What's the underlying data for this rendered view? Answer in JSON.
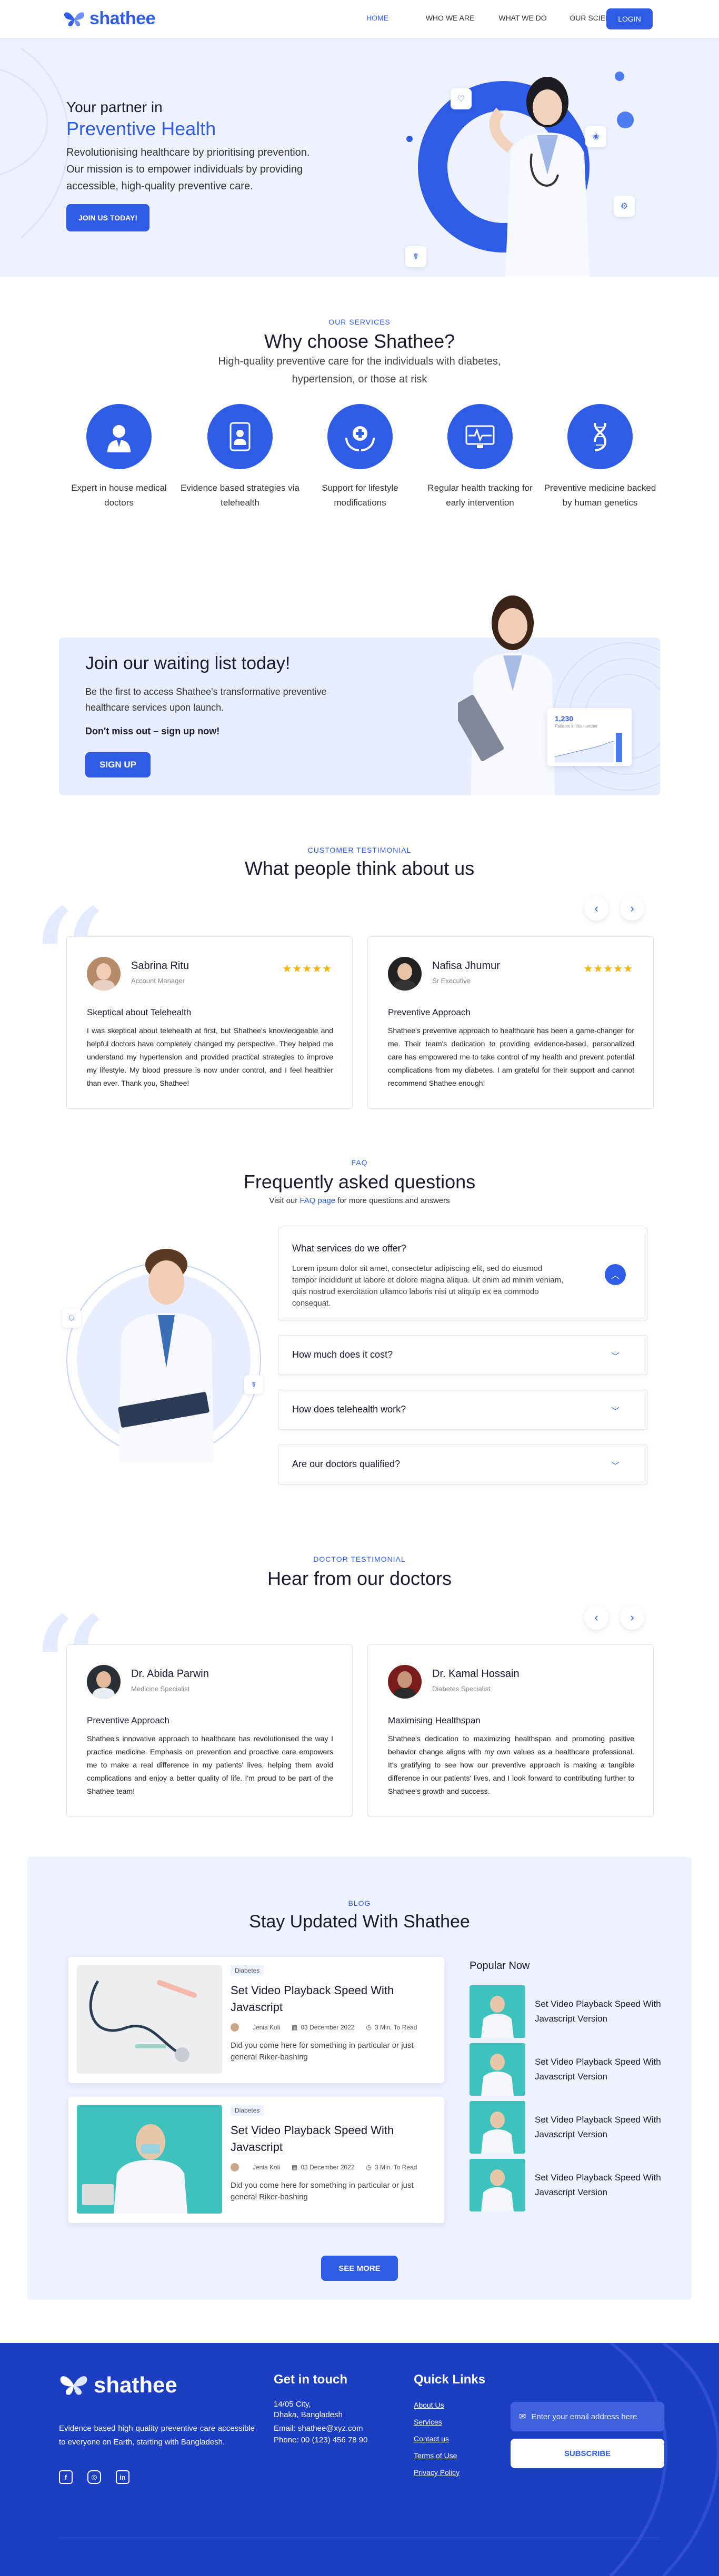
{
  "brand": {
    "name": "shathee",
    "accent": "#2e5ce6",
    "footer_bg": "#1c3ec2"
  },
  "nav": {
    "items": [
      "HOME",
      "WHO WE ARE",
      "WHAT WE DO",
      "OUR SCIENCE"
    ],
    "active": "HOME",
    "login": "LOGIN"
  },
  "hero": {
    "tagline": "Your partner in",
    "headline": "Preventive Health",
    "description": "Revolutionising healthcare by prioritising prevention. Our mission is to empower individuals by providing accessible, high-quality preventive care.",
    "cta": "JOIN US TODAY!"
  },
  "services": {
    "eyebrow": "OUR SERVICES",
    "title": "Why choose Shathee?",
    "subtitle": "High-quality preventive care for the individuals with diabetes, hypertension, or those at risk",
    "items": [
      {
        "label": "Expert in house medical doctors",
        "icon": "doctor-icon"
      },
      {
        "label": "Evidence based strategies via telehealth",
        "icon": "telehealth-icon"
      },
      {
        "label": "Support for lifestyle modifications",
        "icon": "care-hands-icon"
      },
      {
        "label": "Regular health tracking for early intervention",
        "icon": "monitor-icon"
      },
      {
        "label": "Preventive medicine backed by human genetics",
        "icon": "dna-icon"
      }
    ]
  },
  "waitlist": {
    "title": "Join our waiting list today!",
    "text": "Be the first to access Shathee's transformative preventive healthcare services upon launch.",
    "emphasis": "Don't miss out – sign up now!",
    "cta": "SIGN UP",
    "stat_value": "1,230",
    "stat_label": "Patients in this number"
  },
  "customer_testimonials": {
    "eyebrow": "CUSTOMER TESTIMONIAL",
    "title": "What people think about us",
    "cards": [
      {
        "name": "Sabrina Ritu",
        "role": "Account Manager",
        "rating": 5,
        "stars": "★★★★★",
        "headline": "Skeptical about Telehealth",
        "text": "I was skeptical about telehealth at first, but Shathee's knowledgeable and helpful doctors have completely changed my perspective. They helped me understand my hypertension and provided practical strategies to improve my lifestyle. My blood pressure is now under control, and I feel healthier than ever. Thank you, Shathee!"
      },
      {
        "name": "Nafisa Jhumur",
        "role": "Sr Executive",
        "rating": 5,
        "stars": "★★★★★",
        "headline": "Preventive Approach",
        "text": "Shathee's preventive approach to healthcare has been a game-changer for me. Their team's dedication to providing evidence-based, personalized care has empowered me to take control of my health and prevent potential complications from my diabetes. I am grateful for their support and cannot recommend Shathee enough!"
      }
    ]
  },
  "faq": {
    "eyebrow": "FAQ",
    "title": "Frequently asked questions",
    "visit_prefix": "Visit our ",
    "visit_link": "FAQ page",
    "visit_suffix": " for more questions and answers",
    "items": [
      {
        "q": "What services do we offer?",
        "a": "Lorem ipsum dolor sit amet, consectetur adipiscing elit, sed do eiusmod tempor incididunt ut labore et dolore magna aliqua. Ut enim ad minim veniam, quis nostrud exercitation ullamco laboris nisi ut aliquip ex ea commodo consequat.",
        "open": true
      },
      {
        "q": "How much does it cost?",
        "open": false
      },
      {
        "q": "How does telehealth work?",
        "open": false
      },
      {
        "q": "Are our doctors qualified?",
        "open": false
      }
    ]
  },
  "doctor_testimonials": {
    "eyebrow": "DOCTOR TESTIMONIAL",
    "title": "Hear from our doctors",
    "cards": [
      {
        "name": "Dr. Abida Parwin",
        "role": "Medicine Specialist",
        "headline": "Preventive Approach",
        "text": "Shathee's innovative approach to healthcare has revolutionised the way I practice medicine. Emphasis on prevention and proactive care empowers me to make a real difference in my patients' lives, helping them avoid complications and enjoy a better quality of life. I'm proud to be part of the Shathee team!"
      },
      {
        "name": "Dr. Kamal Hossain",
        "role": "Diabetes Specialist",
        "headline": "Maximising Healthspan",
        "text": "Shathee's dedication to maximizing healthspan and promoting positive behavior change aligns with my own values as a healthcare professional. It's gratifying to see how our preventive approach is making a tangible difference in our patients' lives, and I look forward to contributing further to Shathee's growth and success."
      }
    ]
  },
  "blog": {
    "eyebrow": "BLOG",
    "title": "Stay Updated With Shathee",
    "posts": [
      {
        "tag": "Diabetes",
        "title": "Set Video Playback Speed With Javascript",
        "author": "Jenia Koli",
        "date": "03 December 2022",
        "read": "3 Min. To Read",
        "excerpt": "Did you come here for something in particular or just general Riker-bashing"
      },
      {
        "tag": "Diabetes",
        "title": "Set Video Playback Speed With Javascript",
        "author": "Jenia Koli",
        "date": "03 December 2022",
        "read": "3 Min. To Read",
        "excerpt": "Did you come here for something in particular or just general Riker-bashing"
      }
    ],
    "popular_title": "Popular Now",
    "popular": [
      {
        "title": "Set Video Playback Speed With Javascript Version"
      },
      {
        "title": "Set Video Playback Speed With Javascript Version"
      },
      {
        "title": "Set Video Playback Speed With Javascript Version"
      },
      {
        "title": "Set Video Playback Speed With Javascript Version"
      }
    ],
    "see_more": "SEE MORE"
  },
  "footer": {
    "brand": "shathee",
    "tagline": "Evidence based high quality preventive care accessible to everyone on Earth, starting with Bangladesh.",
    "contact_title": "Get in touch",
    "address1": "14/05 City,",
    "address2": "Dhaka, Bangladesh",
    "email": "Email: shathee@xyz.com",
    "phone": "Phone: 00 (123) 456 78 90",
    "links_title": "Quick Links",
    "links": [
      "About Us",
      "Services",
      "Contact us",
      "Terms of Use",
      "Privacy Policy"
    ],
    "email_placeholder": "Enter your email address here",
    "subscribe": "SUBSCRIBE",
    "social": [
      "facebook-icon",
      "instagram-icon",
      "linkedin-icon"
    ]
  }
}
